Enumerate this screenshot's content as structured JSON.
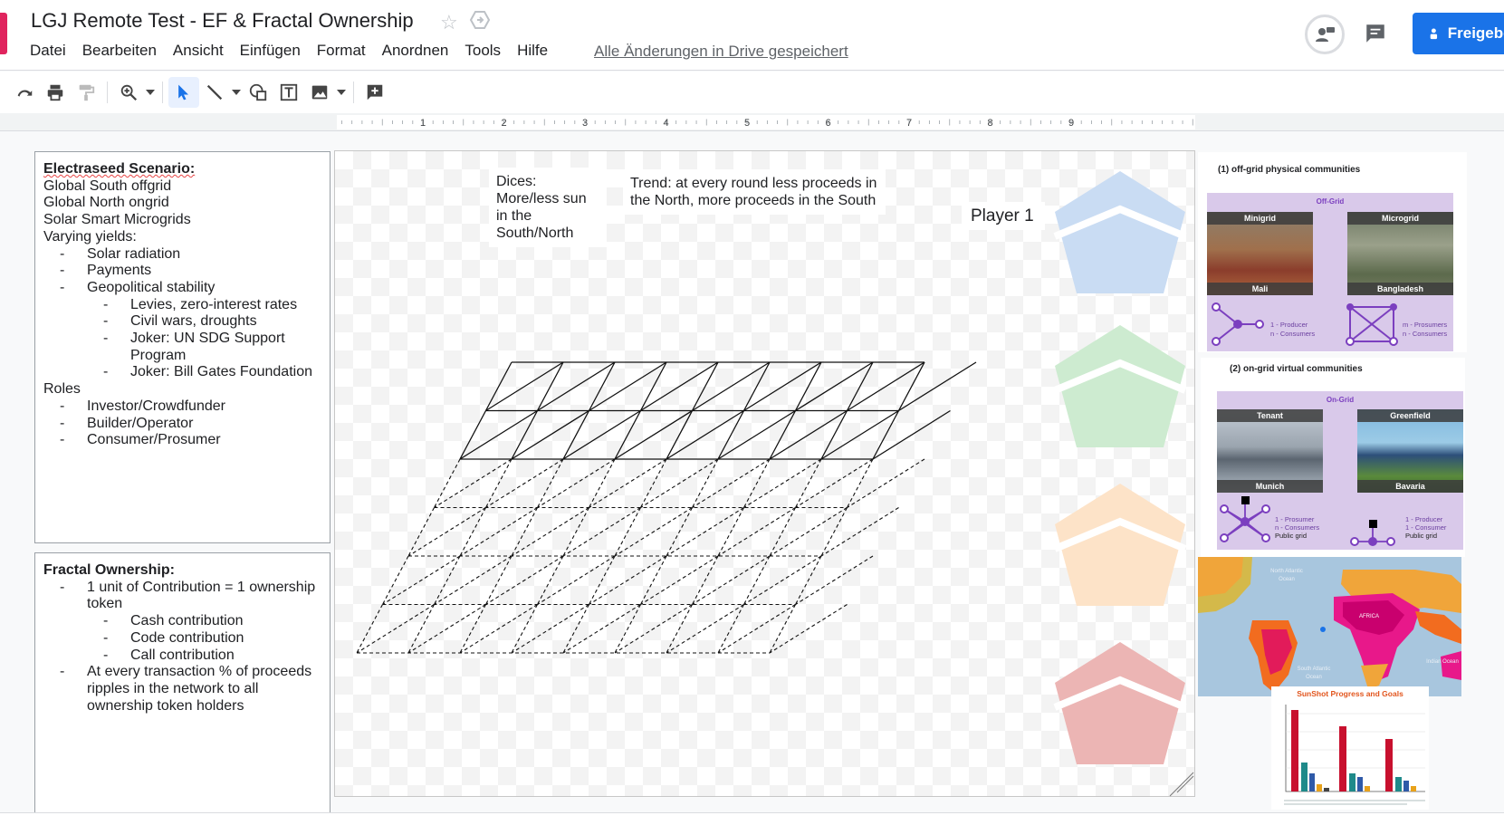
{
  "header": {
    "doc_title": "LGJ Remote Test - EF & Fractal Ownership",
    "menu": [
      "Datei",
      "Bearbeiten",
      "Ansicht",
      "Einfügen",
      "Format",
      "Anordnen",
      "Tools",
      "Hilfe"
    ],
    "save_status": "Alle Änderungen in Drive gespeichert",
    "share_label": "Freigeben",
    "accent_color": "#1a73e8"
  },
  "toolbar": {
    "icons": [
      "redo-icon",
      "print-icon",
      "paint-format-icon",
      "zoom-icon",
      "select-icon",
      "line-icon",
      "shape-icon",
      "textbox-icon",
      "image-icon",
      "add-comment-icon"
    ]
  },
  "ruler": {
    "numbers": [
      "1",
      "2",
      "3",
      "4",
      "5",
      "6",
      "7",
      "8",
      "9"
    ]
  },
  "scenario": {
    "title": "Electraseed Scenario:",
    "lines": [
      "Global South offgrid",
      "Global North ongrid",
      "Solar Smart Microgrids",
      "Varying yields:"
    ],
    "yields": [
      "Solar radiation",
      "Payments",
      "Geopolitical stability"
    ],
    "stability": [
      "Levies, zero-interest rates",
      "Civil wars, droughts",
      "Joker: UN SDG Support Program",
      "Joker: Bill Gates Foundation"
    ],
    "roles_title": "Roles",
    "roles": [
      "Investor/Crowdfunder",
      "Builder/Operator",
      "Consumer/Prosumer"
    ]
  },
  "fractal": {
    "title": "Fractal Ownership:",
    "item1": "1 unit of Contribution = 1 ownership token",
    "contributions": [
      "Cash contribution",
      "Code contribution",
      "Call contribution"
    ],
    "item2": "At every transaction % of proceeds ripples in the network to all ownership token holders"
  },
  "slide": {
    "note_dices": "Dices: More/less sun in the South/North",
    "note_trend": "Trend: at every round less proceeds in the North, more proceeds in the South",
    "player": "Player 1",
    "pentagon_colors": [
      "#c9dcf3",
      "#cdebd0",
      "#fde3c8",
      "#ecb5b4"
    ]
  },
  "panel": {
    "offgrid_title": "(1) off-grid physical communities",
    "offgrid_header": "Off-Grid",
    "minigrid": "Minigrid",
    "microgrid": "Microgrid",
    "mali": "Mali",
    "bangladesh": "Bangladesh",
    "producer_1": "1 - Producer",
    "consumers_n": "n - Consumers",
    "prosumers_m": "m - Prosumers",
    "consumers_n2": "n - Consumers",
    "ongrid_title": "(2) on-grid virtual communities",
    "ongrid_header": "On-Grid",
    "tenant": "Tenant",
    "greenfield": "Greenfield",
    "munich": "Munich",
    "bavaria": "Bavaria",
    "prosumer_1": "1 - Prosumer",
    "consumers_n3": "n - Consumers",
    "public_grid": "Public grid",
    "producer_1b": "1 - Producer",
    "consumer_1": "1 - Consumer",
    "public_grid2": "Public grid",
    "map_labels": [
      "North Atlantic Ocean",
      "AFRICA",
      "South Atlantic Ocean",
      "Indian Ocean"
    ],
    "sunshot_title": "SunShot Progress and Goals"
  }
}
